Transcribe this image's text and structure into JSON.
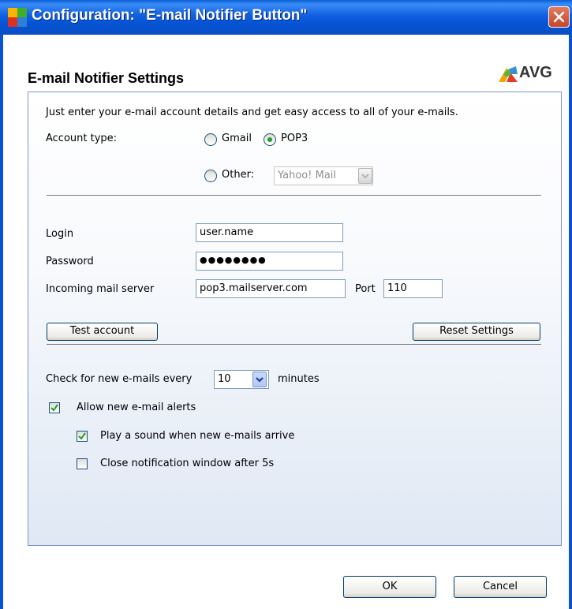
{
  "window": {
    "title": "Configuration: \"E-mail Notifier Button\"",
    "close_icon": "close-icon"
  },
  "header": {
    "title": "E-mail Notifier Settings",
    "logo_text": "AVG"
  },
  "panel": {
    "intro": "Just enter your e-mail account details and get easy access to all of your e-mails.",
    "account_type_label": "Account type:",
    "options": {
      "gmail": {
        "label": "Gmail",
        "selected": false
      },
      "pop3": {
        "label": "POP3",
        "selected": true
      },
      "other": {
        "label": "Other:",
        "selected": false
      }
    },
    "other_select": {
      "value": "Yahoo! Mail",
      "disabled": true
    },
    "login": {
      "label": "Login",
      "value": "user.name"
    },
    "password": {
      "label": "Password",
      "value": "●●●●●●●●"
    },
    "server": {
      "label": "Incoming mail server",
      "value": "pop3.mailserver.com"
    },
    "port": {
      "label": "Port",
      "value": "110"
    },
    "test_button": "Test account",
    "reset_button": "Reset Settings",
    "check_interval": {
      "label_before": "Check for new e-mails every",
      "value": "10",
      "label_after": "minutes"
    },
    "allow_alerts": {
      "label": "Allow new e-mail alerts",
      "checked": true
    },
    "play_sound": {
      "label": "Play a sound when new e-mails arrive",
      "checked": true
    },
    "close_notification": {
      "label": "Close notification window after 5s",
      "checked": false
    }
  },
  "footer": {
    "ok": "OK",
    "cancel": "Cancel"
  },
  "colors": {
    "titlebar": "#0553d3",
    "accent_green": "#21a121",
    "panel_border": "#7a96c8"
  }
}
